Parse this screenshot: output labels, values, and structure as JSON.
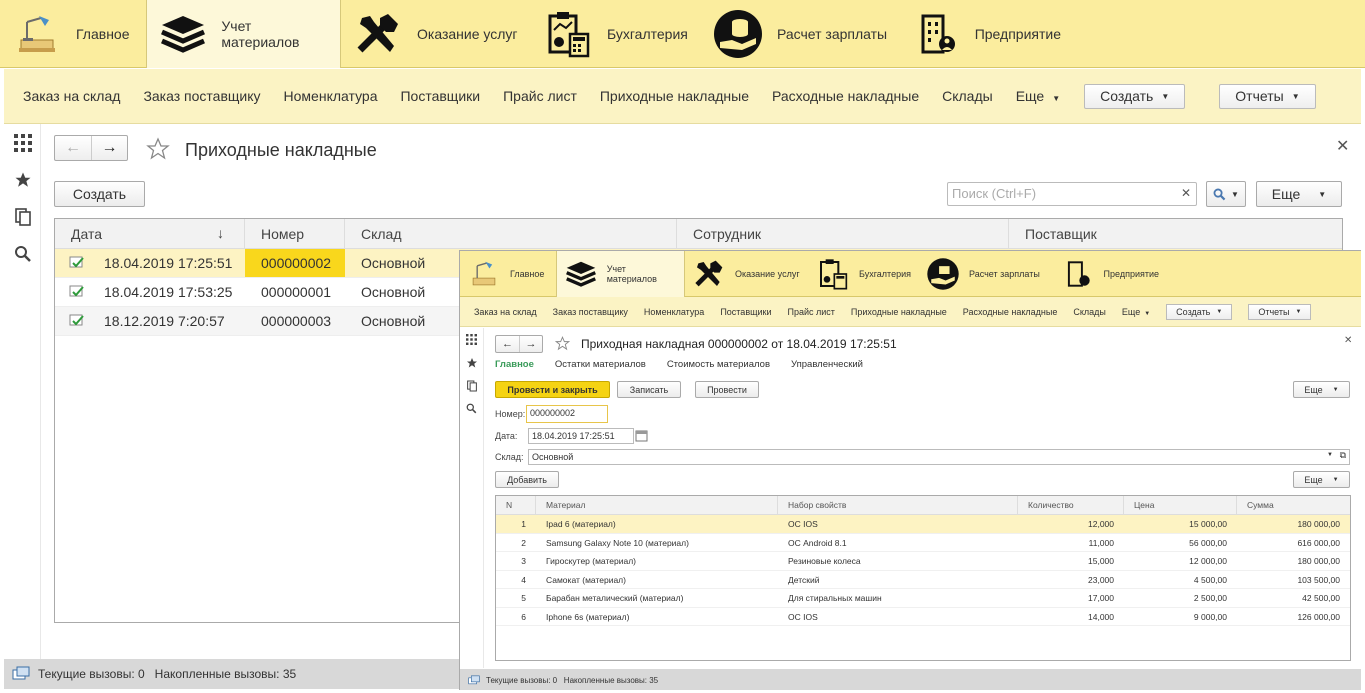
{
  "sections": [
    {
      "label": "Главное",
      "icon": "desk-lamp-icon"
    },
    {
      "label": "Учет материалов",
      "icon": "layers-icon"
    },
    {
      "label": "Оказание услуг",
      "icon": "tools-icon"
    },
    {
      "label": "Бухгалтерия",
      "icon": "clipboard-calculator-icon"
    },
    {
      "label": "Расчет зарплаты",
      "icon": "coins-hand-icon"
    },
    {
      "label": "Предприятие",
      "icon": "building-person-icon"
    }
  ],
  "active_section": "Учет материалов",
  "section_nav": [
    "Заказ на склад",
    "Заказ поставщику",
    "Номенклатура",
    "Поставщики",
    "Прайс лист",
    "Приходные накладные",
    "Расходные накладные",
    "Склады"
  ],
  "section_more": "Еще",
  "create_menu": "Создать",
  "reports_menu": "Отчеты",
  "list": {
    "title": "Приходные накладные",
    "create_button": "Создать",
    "search_placeholder": "Поиск (Ctrl+F)",
    "more_button": "Еще",
    "columns": [
      "Дата",
      "Номер",
      "Склад",
      "Сотрудник",
      "Поставщик"
    ],
    "rows": [
      {
        "date": "18.04.2019 17:25:51",
        "number": "000000002",
        "warehouse": "Основной"
      },
      {
        "date": "18.04.2019 17:53:25",
        "number": "000000001",
        "warehouse": "Основной"
      },
      {
        "date": "18.12.2019 7:20:57",
        "number": "000000003",
        "warehouse": "Основной"
      }
    ]
  },
  "status": {
    "text": "Текущие вызовы: 0   Накопленные вызовы: 35"
  },
  "doc": {
    "title": "Приходная накладная 000000002 от 18.04.2019 17:25:51",
    "tabs": [
      "Главное",
      "Остатки материалов",
      "Стоимость материалов",
      "Управленческий"
    ],
    "btn_post_close": "Провести и закрыть",
    "btn_save": "Записать",
    "btn_post": "Провести",
    "btn_more": "Еще",
    "number_label": "Номер:",
    "number_value": "000000002",
    "date_label": "Дата:",
    "date_value": "18.04.2019 17:25:51",
    "warehouse_label": "Склад:",
    "warehouse_value": "Основной",
    "add_button": "Добавить",
    "columns": [
      "N",
      "Материал",
      "Набор свойств",
      "Количество",
      "Цена",
      "Сумма"
    ],
    "rows": [
      {
        "n": "1",
        "material": "Ipad 6 (материал)",
        "props": "ОС IOS",
        "qty": "12,000",
        "price": "15 000,00",
        "sum": "180 000,00"
      },
      {
        "n": "2",
        "material": "Samsung Galaxy Note 10 (материал)",
        "props": "ОС Android 8.1",
        "qty": "11,000",
        "price": "56 000,00",
        "sum": "616 000,00"
      },
      {
        "n": "3",
        "material": "Гироскутер (материал)",
        "props": "Резиновые колеса",
        "qty": "15,000",
        "price": "12 000,00",
        "sum": "180 000,00"
      },
      {
        "n": "4",
        "material": "Самокат (материал)",
        "props": "Детский",
        "qty": "23,000",
        "price": "4 500,00",
        "sum": "103 500,00"
      },
      {
        "n": "5",
        "material": "Барабан металический (материал)",
        "props": "Для стиральных машин",
        "qty": "17,000",
        "price": "2 500,00",
        "sum": "42 500,00"
      },
      {
        "n": "6",
        "material": "Iphone 6s (материал)",
        "props": "ОС IOS",
        "qty": "14,000",
        "price": "9 000,00",
        "sum": "126 000,00"
      }
    ]
  },
  "colors": {
    "accent_yellow": "#fbed9e",
    "selected_row": "#fdf3c3",
    "selected_cell": "#f9d71c",
    "primary_button": "#f5d313",
    "active_tab": "#3a9b5a"
  }
}
